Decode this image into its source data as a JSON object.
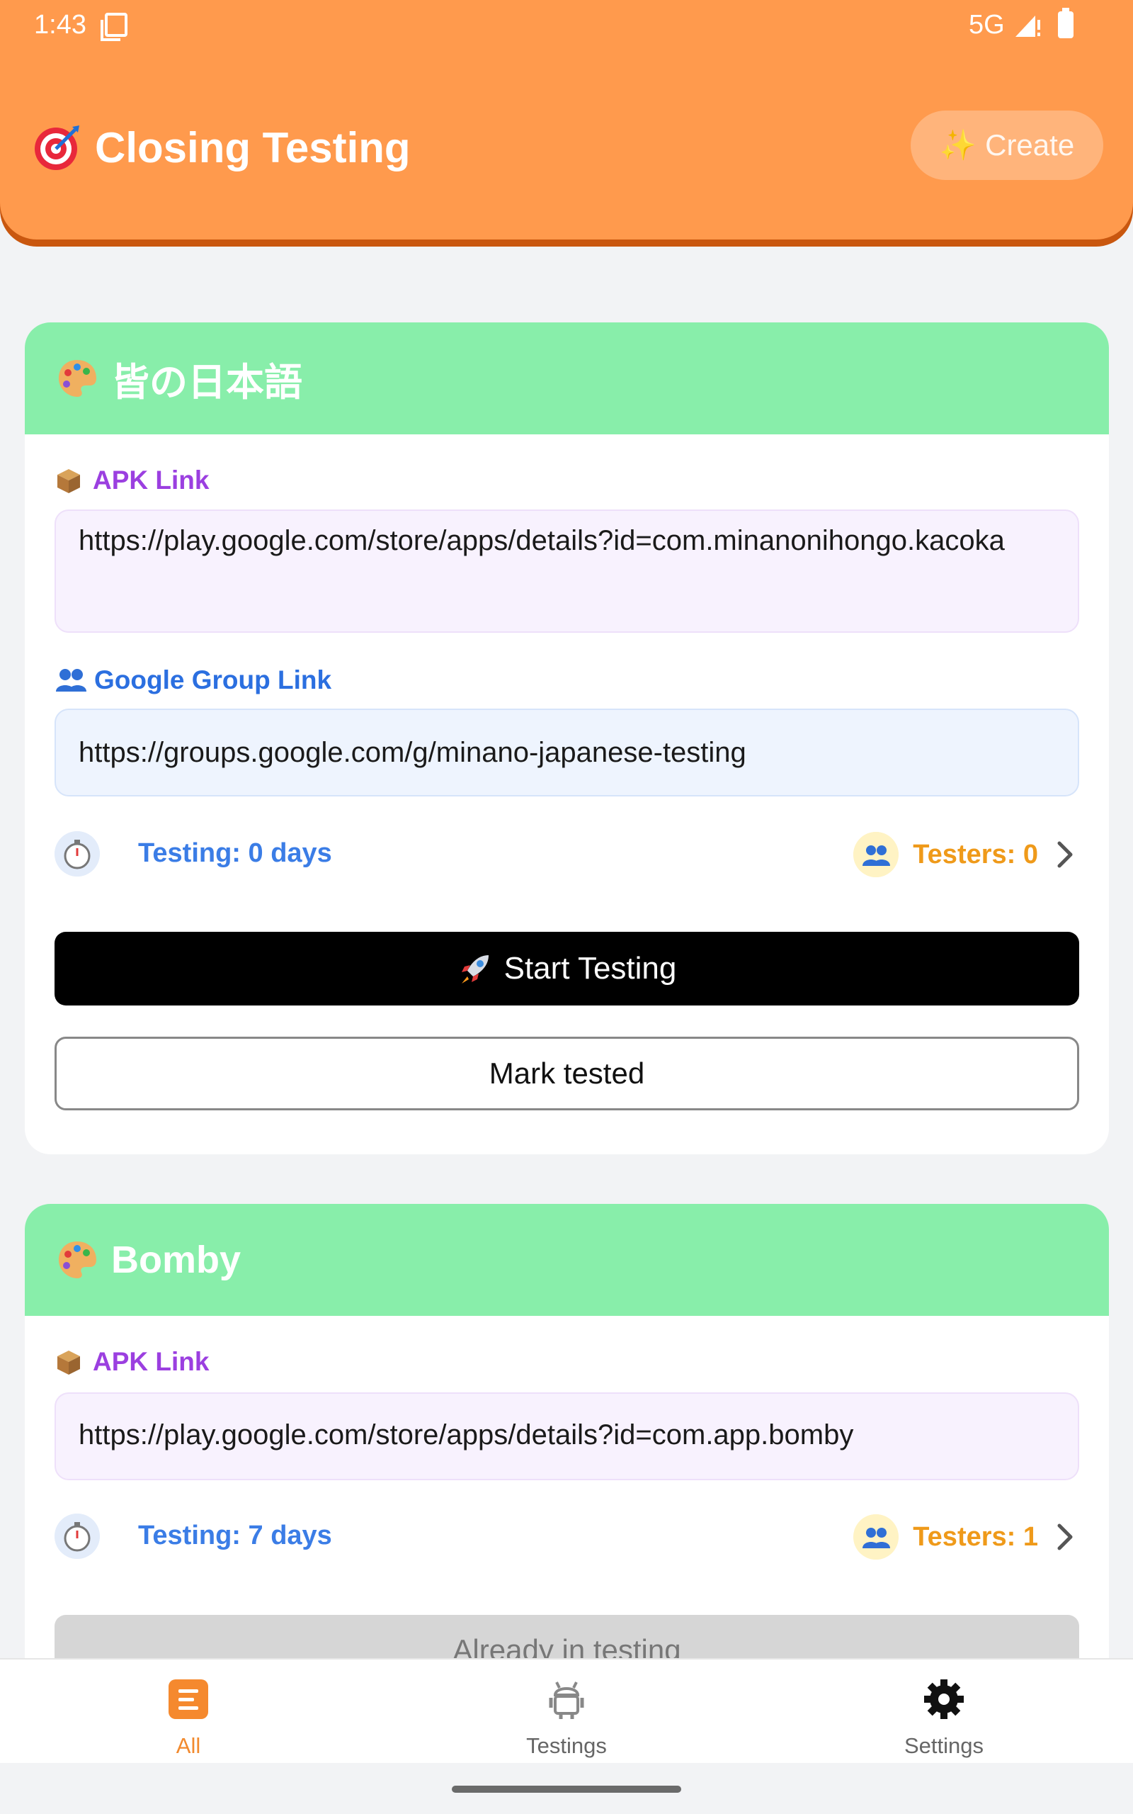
{
  "status_bar": {
    "time": "1:43",
    "network": "5G"
  },
  "header": {
    "title": "Closing Testing",
    "create_label": "Create",
    "title_icon": "target-icon",
    "create_icon": "sparkles-icon"
  },
  "apps": [
    {
      "name": "皆の日本語",
      "apk_label": "APK Link",
      "apk_url": "https://play.google.com/store/apps/details?id=com.minanonihongo.kacoka",
      "group_label": "Google Group Link",
      "group_url": "https://groups.google.com/g/minano-japanese-testing",
      "testing_prefix": "Testing:",
      "testing_value": "0 days",
      "testers_text": "Testers: 0",
      "primary_button": "Start Testing",
      "secondary_button": "Mark tested"
    },
    {
      "name": "Bomby",
      "apk_label": "APK Link",
      "apk_url": "https://play.google.com/store/apps/details?id=com.app.bomby",
      "testing_prefix": "Testing:",
      "testing_value": "7 days",
      "testers_text": "Testers: 1",
      "disabled_button": "Already in testing"
    }
  ],
  "bottom_nav": {
    "items": [
      {
        "label": "All",
        "icon": "list-icon",
        "active": true
      },
      {
        "label": "Testings",
        "icon": "android-icon",
        "active": false
      },
      {
        "label": "Settings",
        "icon": "gear-icon",
        "active": false
      }
    ]
  },
  "colors": {
    "header": "#ff9a4d",
    "card_header": "#88eeaa",
    "apk_label": "#9b3fe0",
    "group_label": "#2b6fe0",
    "testing": "#3b7de6",
    "testers": "#ef9a1a",
    "active_nav": "#f28a2e"
  }
}
